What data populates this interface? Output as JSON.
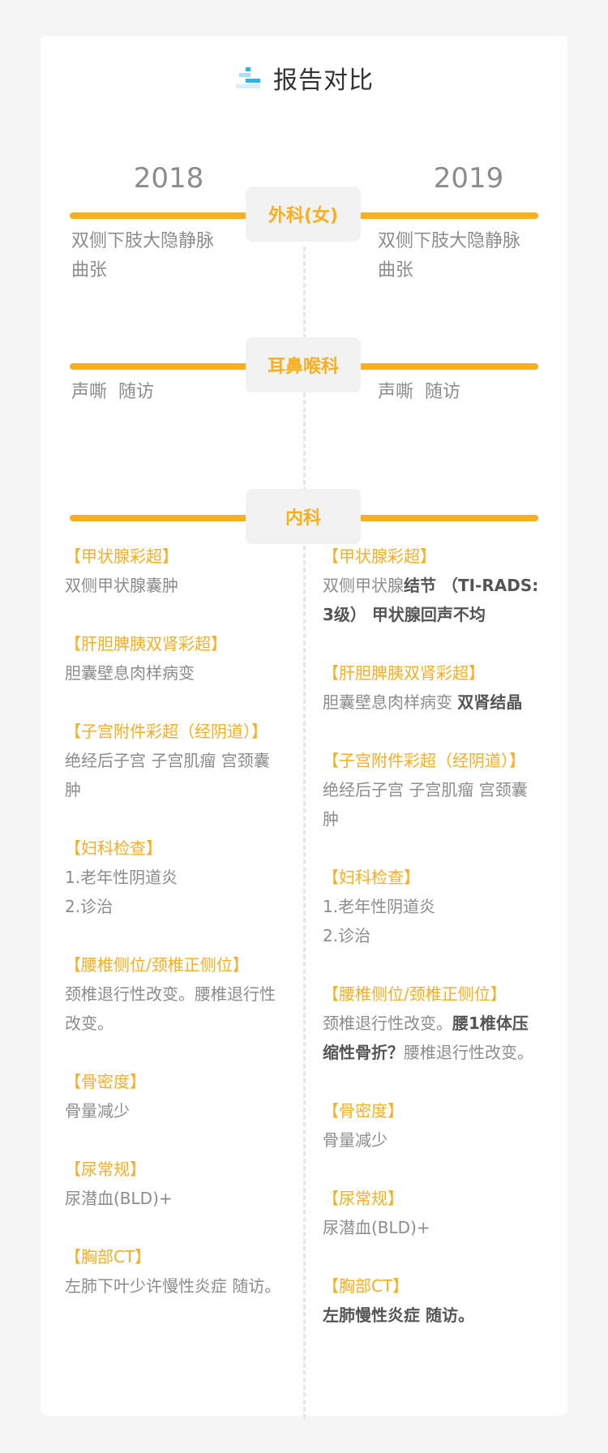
{
  "header": {
    "title": "报告对比",
    "icon": "report-icon"
  },
  "years": {
    "left": "2018",
    "right": "2019"
  },
  "sections": {
    "surgery": {
      "label": "外科(女)",
      "left": [
        "双侧下肢大隐静脉",
        "曲张"
      ],
      "right": [
        "双侧下肢大隐静脉",
        "曲张"
      ]
    },
    "ent": {
      "label": "耳鼻喉科",
      "left": [
        "声嘶  随访"
      ],
      "right": [
        "声嘶  随访"
      ]
    },
    "internal": {
      "label": "内科"
    }
  },
  "internal_left": [
    {
      "title": "【甲状腺彩超】",
      "lines": [
        [
          "双侧甲状腺囊肿"
        ]
      ]
    },
    {
      "title": "【肝胆脾胰双肾彩超】",
      "lines": [
        [
          "胆囊壁息肉样病变"
        ]
      ]
    },
    {
      "title": "【子宫附件彩超（经阴道）】",
      "lines": [
        [
          "绝经后子宫 子宫肌瘤 宫颈囊"
        ],
        [
          "肿"
        ]
      ]
    },
    {
      "title": "【妇科检查】",
      "lines": [
        [
          "1.老年性阴道炎"
        ],
        [
          "2.诊治"
        ]
      ]
    },
    {
      "title": "【腰椎侧位/颈椎正侧位】",
      "lines": [
        [
          "颈椎退行性改变。腰椎退行性"
        ],
        [
          "改变。"
        ]
      ]
    },
    {
      "title": "【骨密度】",
      "lines": [
        [
          "骨量减少"
        ]
      ]
    },
    {
      "title": "【尿常规】",
      "lines": [
        [
          "尿潜血(BLD)+"
        ]
      ]
    },
    {
      "title": "【胸部CT】",
      "lines": [
        [
          "左肺下叶少许慢性炎症 随访。"
        ]
      ]
    }
  ],
  "internal_right": [
    {
      "title": "【甲状腺彩超】",
      "lines": [
        [
          "双侧甲状腺",
          "结节 （TI-RADS:"
        ],
        [
          "",
          "3级） 甲状腺回声不均"
        ]
      ]
    },
    {
      "title": "【肝胆脾胰双肾彩超】",
      "lines": [
        [
          "胆囊壁息肉样病变 ",
          "双肾结晶"
        ]
      ]
    },
    {
      "title": "【子宫附件彩超（经阴道）】",
      "lines": [
        [
          "绝经后子宫 子宫肌瘤 宫颈囊"
        ],
        [
          "肿"
        ]
      ]
    },
    {
      "title": "【妇科检查】",
      "lines": [
        [
          "1.老年性阴道炎"
        ],
        [
          "2.诊治"
        ]
      ]
    },
    {
      "title": "【腰椎侧位/颈椎正侧位】",
      "lines": [
        [
          "颈椎退行性改变。",
          "腰1椎体压"
        ],
        [
          "",
          "缩性骨折？",
          "腰椎退行性改变。"
        ]
      ]
    },
    {
      "title": "【骨密度】",
      "lines": [
        [
          "骨量减少"
        ]
      ]
    },
    {
      "title": "【尿常规】",
      "lines": [
        [
          "尿潜血(BLD)+"
        ]
      ]
    },
    {
      "title": "【胸部CT】",
      "lines": [
        [
          "",
          "左肺慢性炎症 随访。"
        ]
      ]
    }
  ]
}
